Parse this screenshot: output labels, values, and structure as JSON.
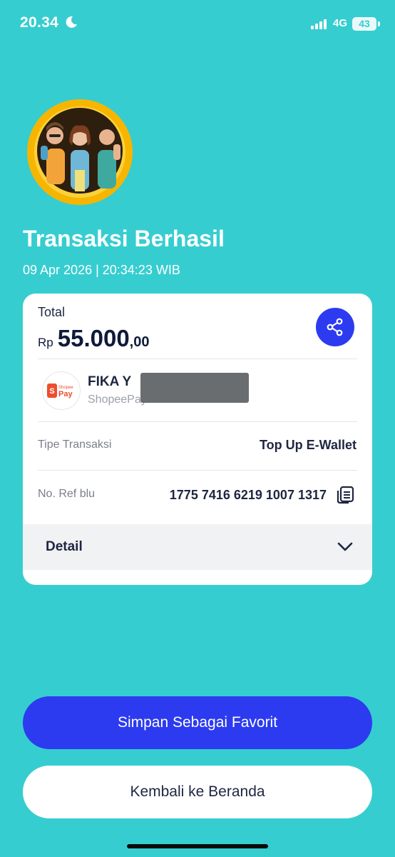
{
  "status_bar": {
    "time": "20.34",
    "network": "4G",
    "battery": "43"
  },
  "header": {
    "title": "Transaksi Berhasil",
    "datetime": "09 Apr 2026 | 20:34:23 WIB"
  },
  "card": {
    "total_label": "Total",
    "currency": "Rp",
    "amount_main": "55.000",
    "amount_decimal": ",00",
    "merchant": {
      "name": "FIKA Y",
      "subtitle": "ShopeePay",
      "logo_text_small": "Shopee",
      "logo_text_big": "Pay"
    },
    "rows": [
      {
        "label": "Tipe Transaksi",
        "value": "Top Up E-Wallet"
      },
      {
        "label": "No. Ref blu",
        "value": "1775 7416 6219 1007 1317"
      }
    ],
    "detail_label": "Detail"
  },
  "buttons": {
    "save_favorite": "Simpan Sebagai Favorit",
    "back_home": "Kembali ke Beranda"
  },
  "colors": {
    "background": "#36CDD0",
    "primary": "#2C3BF0",
    "shopee": "#EE4D2D"
  },
  "icons": [
    "moon-icon",
    "signal-icon",
    "battery-icon",
    "share-icon",
    "copy-icon",
    "chevron-down-icon",
    "shopeepay-logo"
  ]
}
